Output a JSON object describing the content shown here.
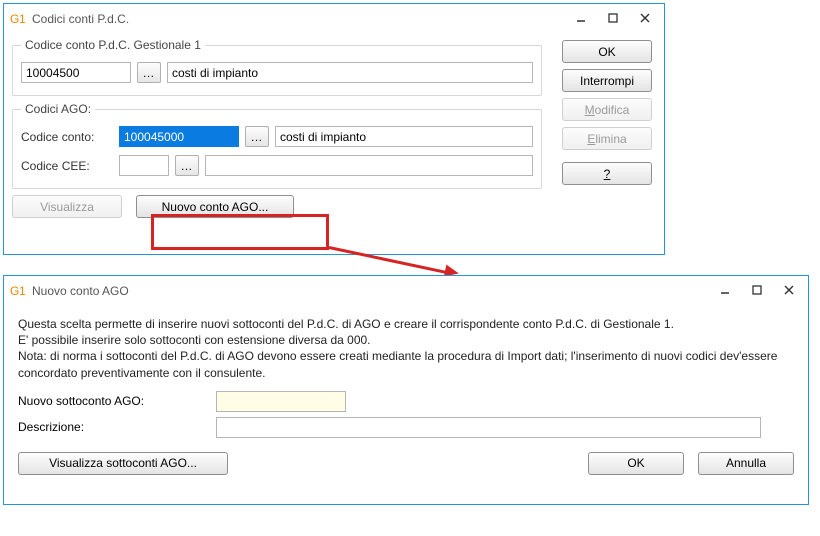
{
  "win1": {
    "title": "Codici conti P.d.C.",
    "group_gest1": {
      "legend": "Codice conto P.d.C. Gestionale 1",
      "code": "10004500",
      "ellipsis": "…",
      "descr": "costi di impianto"
    },
    "group_ago": {
      "legend": "Codici AGO:",
      "codice_conto_label": "Codice conto:",
      "codice_conto_value": "100045000",
      "codice_conto_ellipsis": "…",
      "codice_conto_descr": "costi di impianto",
      "codice_cee_label": "Codice CEE:",
      "codice_cee_value": "",
      "codice_cee_ellipsis": "…",
      "codice_cee_descr": ""
    },
    "visualizza": "Visualizza",
    "nuovo_conto_ago": "Nuovo conto AGO...",
    "side": {
      "ok": "OK",
      "interrompi": "Interrompi",
      "modifica": "Modifica",
      "elimina": "Elimina",
      "help": "?"
    }
  },
  "win2": {
    "title": "Nuovo conto AGO",
    "desc_line1": "Questa scelta permette di inserire nuovi sottoconti del P.d.C. di AGO e creare il corrispondente conto P.d.C. di Gestionale 1.",
    "desc_line2": "E' possibile inserire solo sottoconti con estensione diversa da 000.",
    "desc_line3": "Nota: di norma i sottoconti del P.d.C. di AGO devono essere creati mediante la procedura di Import dati; l'inserimento di nuovi codici dev'essere concordato preventivamente con il consulente.",
    "nuovo_sottoconto_label": "Nuovo sottoconto AGO:",
    "nuovo_sottoconto_value": "",
    "descrizione_label": "Descrizione:",
    "descrizione_value": "",
    "visualizza_sottoconti": "Visualizza sottoconti AGO...",
    "ok": "OK",
    "annulla": "Annulla"
  },
  "colors": {
    "accent": "#2494e2",
    "callout": "#d62424"
  }
}
